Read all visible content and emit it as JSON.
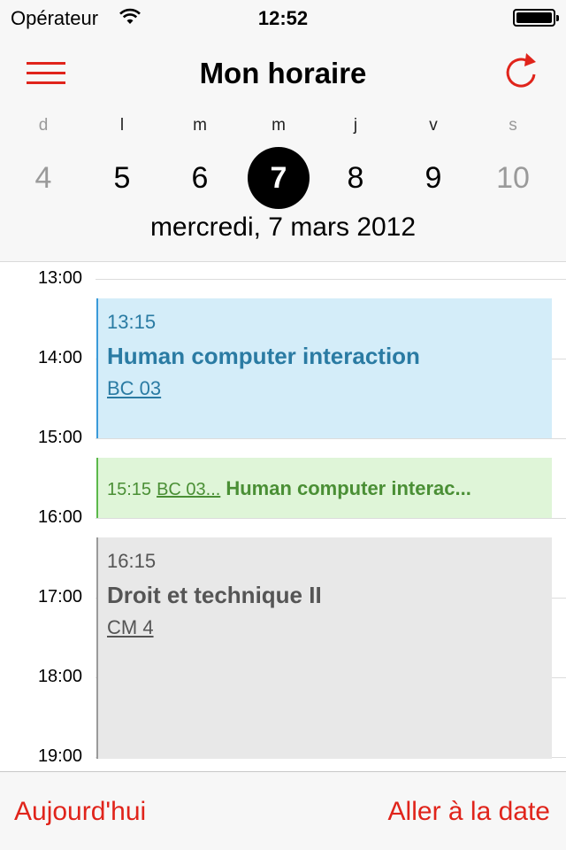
{
  "status": {
    "carrier": "Opérateur",
    "time": "12:52"
  },
  "nav": {
    "title": "Mon horaire",
    "menu_icon": "hamburger-menu-icon",
    "refresh_icon": "refresh-icon"
  },
  "colors": {
    "accent": "#e0241b",
    "blue_event": "#d4edf9",
    "green_event": "#dff5d8",
    "gray_event": "#e8e8e8"
  },
  "week": {
    "days": [
      {
        "letter": "d",
        "number": "4"
      },
      {
        "letter": "l",
        "number": "5"
      },
      {
        "letter": "m",
        "number": "6"
      },
      {
        "letter": "m",
        "number": "7"
      },
      {
        "letter": "j",
        "number": "8"
      },
      {
        "letter": "v",
        "number": "9"
      },
      {
        "letter": "s",
        "number": "10"
      }
    ],
    "selected_label": "mercredi, 7 mars 2012"
  },
  "timeline": {
    "hours": [
      "13:00",
      "14:00",
      "15:00",
      "16:00",
      "17:00",
      "18:00",
      "19:00"
    ],
    "events": [
      {
        "time": "13:15",
        "title": "Human computer interaction",
        "room": "BC 03"
      },
      {
        "time": "15:15",
        "room": "BC 03...",
        "title": "Human computer interac..."
      },
      {
        "time": "16:15",
        "title": "Droit et technique II",
        "room": "CM 4"
      }
    ]
  },
  "toolbar": {
    "today": "Aujourd'hui",
    "go_to_date": "Aller à la date"
  }
}
